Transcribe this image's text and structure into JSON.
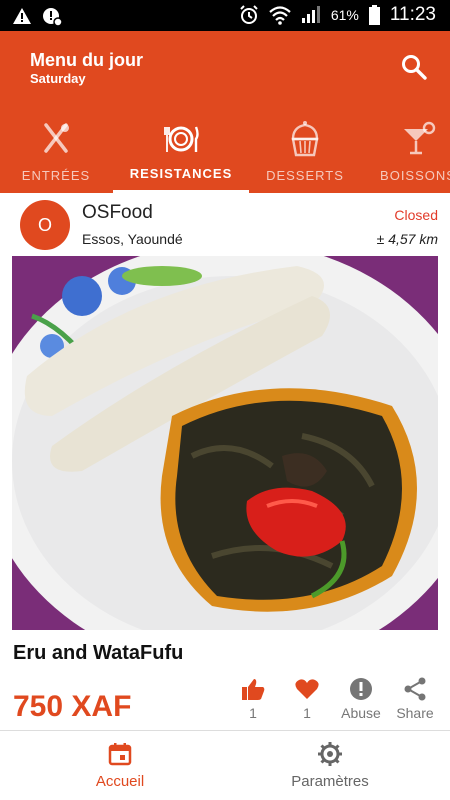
{
  "status_bar": {
    "battery": "61%",
    "time": "11:23"
  },
  "app": {
    "title": "Menu du jour",
    "subtitle": "Saturday"
  },
  "tabs": [
    {
      "label": "ENTRÉES",
      "icon": "fork-knife-icon"
    },
    {
      "label": "RESISTANCES",
      "icon": "plate-icon",
      "active": true
    },
    {
      "label": "DESSERTS",
      "icon": "cupcake-icon"
    },
    {
      "label": "BOISSONS",
      "icon": "cocktail-icon"
    }
  ],
  "restaurant": {
    "avatar_letter": "O",
    "name": "OSFood",
    "location": "Essos, Yaoundé",
    "status": "Closed",
    "distance": "± 4,57 km"
  },
  "dish": {
    "name": "Eru and WataFufu",
    "price": "750 XAF"
  },
  "actions": [
    {
      "icon": "thumbs-up-icon",
      "label": "1"
    },
    {
      "icon": "heart-icon",
      "label": "1"
    },
    {
      "icon": "alert-icon",
      "label": "Abuse"
    },
    {
      "icon": "share-icon",
      "label": "Share"
    }
  ],
  "bottom_nav": [
    {
      "label": "Accueil",
      "icon": "calendar-icon",
      "active": true
    },
    {
      "label": "Paramètres",
      "icon": "settings-gear-icon"
    }
  ],
  "colors": {
    "accent": "#e0491f",
    "status_closed": "#e23b2a"
  }
}
